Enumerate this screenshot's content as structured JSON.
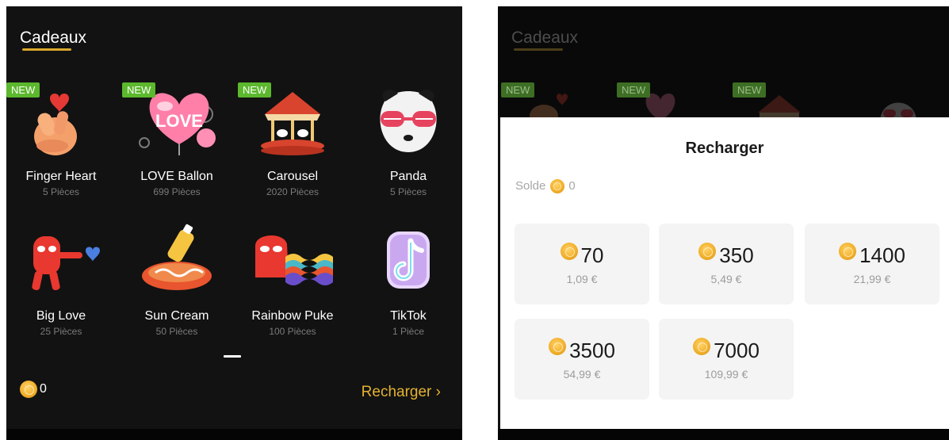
{
  "left_panel": {
    "tab_label": "Cadeaux",
    "gifts": [
      {
        "name": "Finger Heart",
        "price": "5 Pièces",
        "badge": "NEW"
      },
      {
        "name": "LOVE Ballon",
        "price": "699 Pièces",
        "badge": "NEW",
        "art_text": "LOVE"
      },
      {
        "name": "Carousel",
        "price": "2020 Pièces",
        "badge": "NEW"
      },
      {
        "name": "Panda",
        "price": "5 Pièces"
      },
      {
        "name": "Big Love",
        "price": "25 Pièces"
      },
      {
        "name": "Sun Cream",
        "price": "50 Pièces"
      },
      {
        "name": "Rainbow Puke",
        "price": "100 Pièces"
      },
      {
        "name": "TikTok",
        "price": "1 Pièce"
      }
    ],
    "balance": "0",
    "recharge_label": "Recharger ›"
  },
  "right_panel": {
    "tab_label": "Cadeaux",
    "badges": [
      "NEW",
      "NEW",
      "NEW"
    ],
    "sheet": {
      "title": "Recharger",
      "solde_label": "Solde",
      "solde_value": "0",
      "packages": [
        {
          "coins": "70",
          "price": "1,09 €"
        },
        {
          "coins": "350",
          "price": "5,49 €"
        },
        {
          "coins": "1400",
          "price": "21,99 €"
        },
        {
          "coins": "3500",
          "price": "54,99 €"
        },
        {
          "coins": "7000",
          "price": "109,99 €"
        }
      ]
    }
  },
  "colors": {
    "background": "#121212",
    "accent_gold": "#e3b231",
    "new_badge": "#5cb82d",
    "sheet": "#ffffff",
    "package_tile": "#f4f4f4"
  },
  "icons": [
    "coin-icon",
    "chevron-right-icon"
  ]
}
